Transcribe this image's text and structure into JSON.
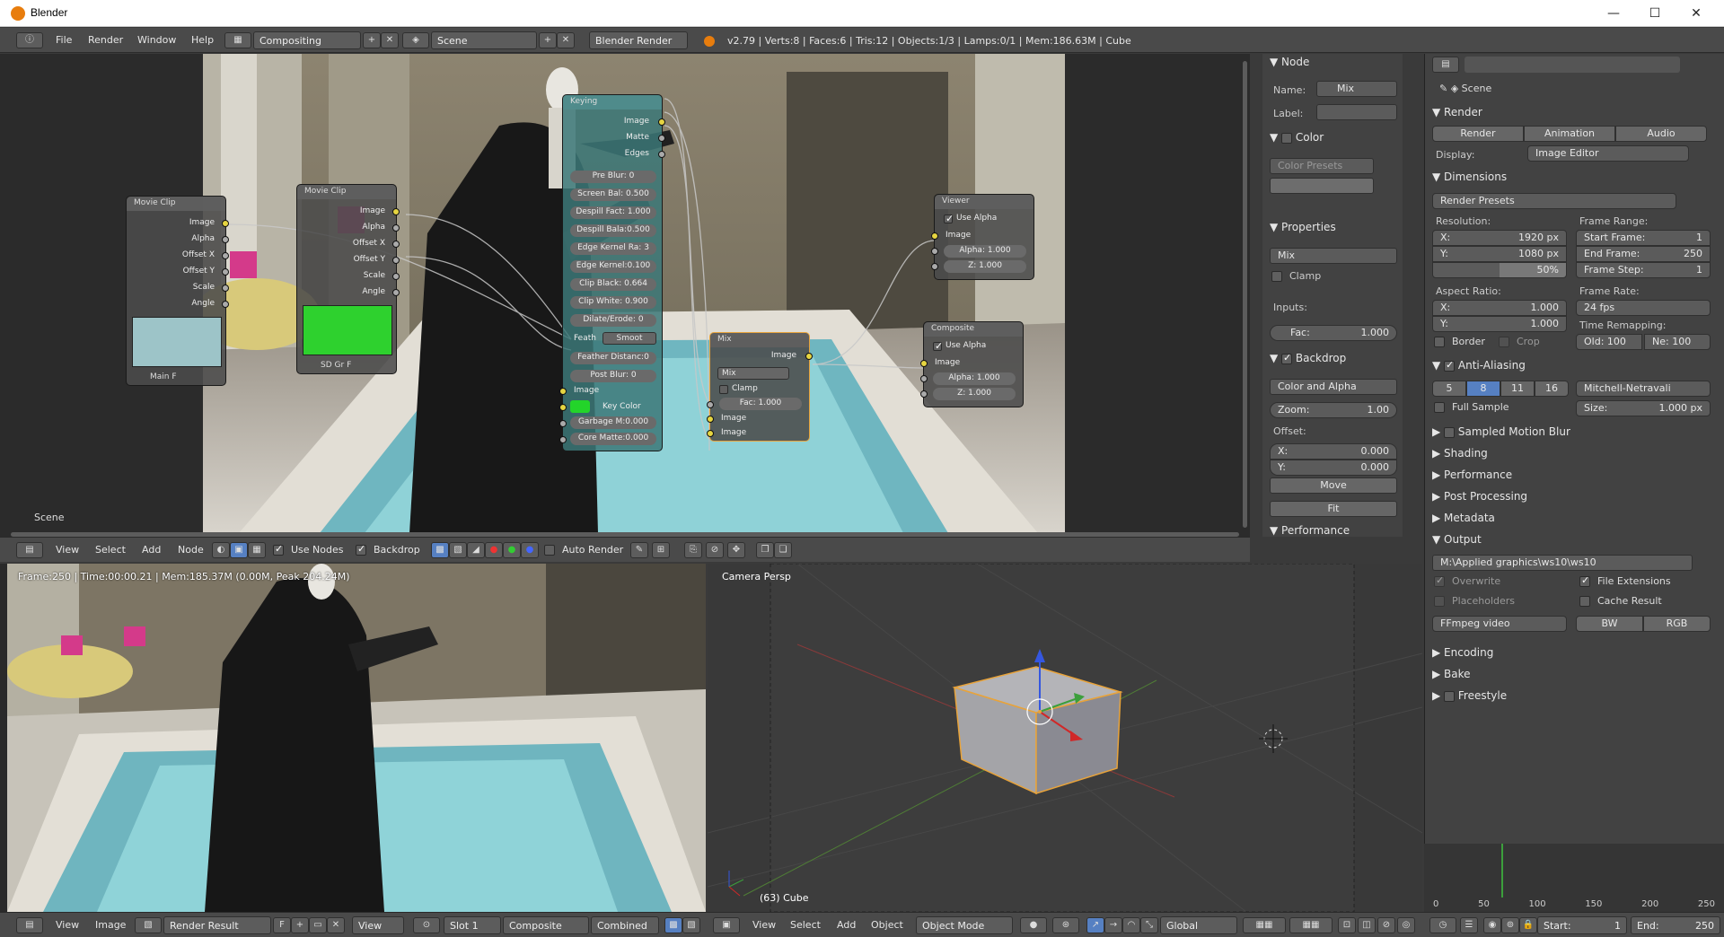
{
  "window": {
    "title": "Blender",
    "minimize": "—",
    "maximize": "☐",
    "close": "✕"
  },
  "infobar": {
    "menus": [
      "File",
      "Render",
      "Window",
      "Help"
    ],
    "layout": "Compositing",
    "scene": "Scene",
    "engine": "Blender Render",
    "stats": "v2.79 | Verts:8 | Faces:6 | Tris:12 | Objects:1/3 | Lamps:0/1 | Mem:186.63M | Cube"
  },
  "node_editor": {
    "scene_label": "Scene",
    "nodes": {
      "movieclip1": {
        "title": "Movie Clip",
        "outputs": [
          "Image",
          "Alpha",
          "Offset X",
          "Offset Y",
          "Scale",
          "Angle"
        ],
        "footer": "Main",
        "footer_f": "F"
      },
      "movieclip2": {
        "title": "Movie Clip",
        "outputs": [
          "Image",
          "Alpha",
          "Offset X",
          "Offset Y",
          "Scale",
          "Angle"
        ],
        "footer": "SD Gr",
        "footer_f": "F"
      },
      "keying": {
        "title": "Keying",
        "outputs": [
          "Image",
          "Matte",
          "Edges"
        ],
        "fields": [
          "Pre Blur:",
          "Screen Bal: 0.500",
          "Despill Fact: 1.000",
          "Despill Bala:0.500",
          "Edge Kernel Ra: 3",
          "Edge Kernel:0.100",
          "Clip Black: 0.664",
          "Clip White: 0.900",
          "Dilate/Erode:"
        ],
        "pre_blur_val": "0",
        "dilate_val": "0",
        "feather_label": "Feath",
        "feather_value": "Smoot",
        "feather_dist": "Feather Distanc:0",
        "post_blur": "Post Blur:",
        "post_blur_val": "0",
        "input_image": "Image",
        "key_color": "Key Color",
        "garbage": "Garbage M:0.000",
        "core": "Core Matte:0.000"
      },
      "viewer": {
        "title": "Viewer",
        "use_alpha": "Use Alpha",
        "image": "Image",
        "alpha": "Alpha:",
        "alpha_val": "1.000",
        "z": "Z:",
        "z_val": "1.000"
      },
      "composite": {
        "title": "Composite",
        "use_alpha": "Use Alpha",
        "image": "Image",
        "alpha": "Alpha:",
        "alpha_val": "1.000",
        "z": "Z:",
        "z_val": "1.000"
      },
      "mix": {
        "title": "Mix",
        "image_out": "Image",
        "mode": "Mix",
        "clamp": "Clamp",
        "fac": "Fac:",
        "fac_val": "1.000",
        "in1": "Image",
        "in2": "Image"
      }
    },
    "header": {
      "menus": [
        "View",
        "Select",
        "Add",
        "Node"
      ],
      "use_nodes": "Use Nodes",
      "backdrop": "Backdrop",
      "auto_render": "Auto Render"
    }
  },
  "npanel": {
    "node_section": "Node",
    "name_label": "Name:",
    "name_value": "Mix",
    "label_label": "Label:",
    "color_section": "Color",
    "color_presets": "Color Presets",
    "properties_section": "Properties",
    "mode": "Mix",
    "clamp": "Clamp",
    "inputs": "Inputs:",
    "fac_label": "Fac:",
    "fac_value": "1.000",
    "backdrop_section": "Backdrop",
    "channels": "Color and Alpha",
    "zoom_label": "Zoom:",
    "zoom_value": "1.00",
    "offset": "Offset:",
    "x_label": "X:",
    "x_value": "0.000",
    "y_label": "Y:",
    "y_value": "0.000",
    "move": "Move",
    "fit": "Fit",
    "performance": "Performance"
  },
  "properties": {
    "scene": "Scene",
    "render_section": "Render",
    "render_btn": "Render",
    "animation_btn": "Animation",
    "audio_btn": "Audio",
    "display_label": "Display:",
    "display_value": "Image Editor",
    "dimensions_section": "Dimensions",
    "render_presets": "Render Presets",
    "resolution": "Resolution:",
    "res_x_label": "X:",
    "res_x": "1920 px",
    "res_y_label": "Y:",
    "res_y": "1080 px",
    "res_pct": "50%",
    "frame_range": "Frame Range:",
    "start_label": "Start Frame:",
    "start": "1",
    "end_label": "End Frame:",
    "end": "250",
    "step_label": "Frame Step:",
    "step": "1",
    "aspect": "Aspect Ratio:",
    "asp_x_label": "X:",
    "asp_x": "1.000",
    "asp_y_label": "Y:",
    "asp_y": "1.000",
    "frame_rate": "Frame Rate:",
    "fps": "24 fps",
    "time_remap": "Time Remapping:",
    "old_label": "Old:",
    "old": "100",
    "new_label": "Ne:",
    "new": "100",
    "border": "Border",
    "crop": "Crop",
    "aa_section": "Anti-Aliasing",
    "aa_samples": [
      "5",
      "8",
      "11",
      "16"
    ],
    "aa_filter": "Mitchell-Netravali",
    "full_sample": "Full Sample",
    "size_label": "Size:",
    "size": "1.000 px",
    "collapsed": [
      "Sampled Motion Blur",
      "Shading",
      "Performance",
      "Post Processing",
      "Metadata"
    ],
    "output_section": "Output",
    "output_path": "M:\\Applied graphics\\ws10\\ws10",
    "overwrite": "Overwrite",
    "file_ext": "File Extensions",
    "placeholders": "Placeholders",
    "cache": "Cache Result",
    "format": "FFmpeg video",
    "bw": "BW",
    "rgb": "RGB",
    "encoding": "Encoding",
    "bake": "Bake",
    "freestyle": "Freestyle"
  },
  "image_editor": {
    "info": "Frame:250 | Time:00:00.21 | Mem:185.37M (0.00M, Peak 204.24M)",
    "header": {
      "menus": [
        "View",
        "Image"
      ],
      "image": "Render Result",
      "f": "F",
      "view": "View",
      "slot": "Slot 1",
      "layer": "Composite",
      "pass": "Combined"
    }
  },
  "viewport": {
    "label": "Camera Persp",
    "object": "(63) Cube",
    "header": {
      "menus": [
        "View",
        "Select",
        "Add",
        "Object"
      ],
      "mode": "Object Mode",
      "orientation": "Global"
    }
  },
  "timeline": {
    "ticks": [
      "0",
      "50",
      "100",
      "150",
      "200",
      "250"
    ],
    "start_label": "Start:",
    "start": "1",
    "end_label": "End:",
    "end": "250"
  }
}
